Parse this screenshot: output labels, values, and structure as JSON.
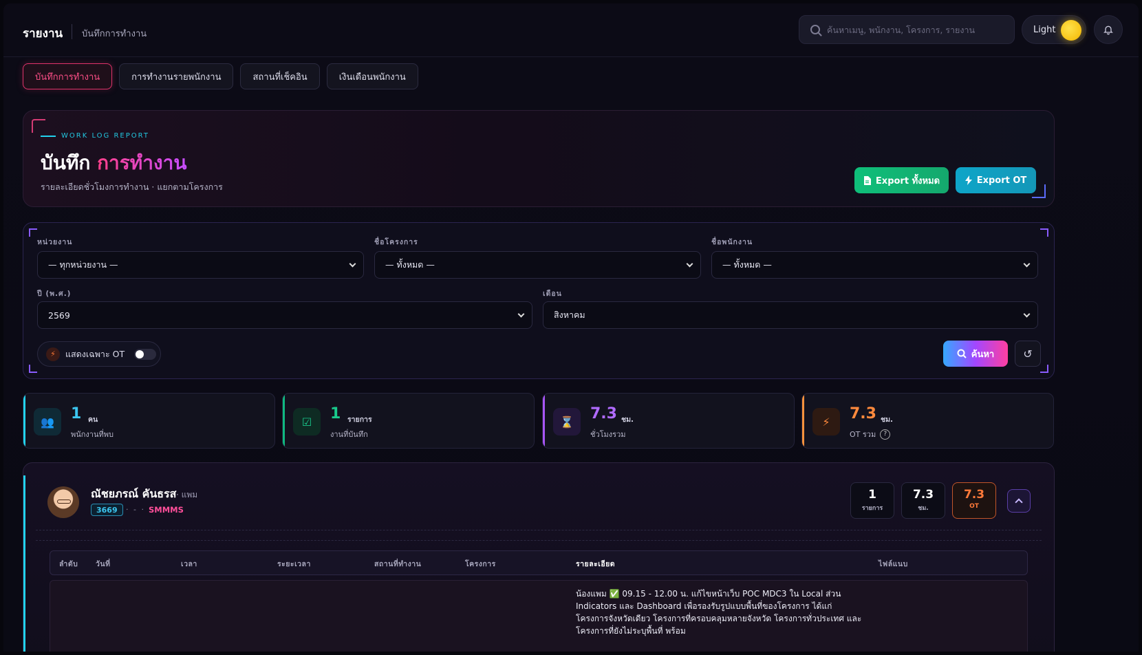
{
  "header": {
    "title": "รายงาน",
    "subtitle": "บันทึกการทำงาน",
    "search_placeholder": "ค้นหาเมนู, พนักงาน, โครงการ, รายงาน",
    "theme_label": "Light"
  },
  "tabs": [
    {
      "label": "บันทึกการทำงาน",
      "active": true
    },
    {
      "label": "การทำงานรายพนักงาน",
      "active": false
    },
    {
      "label": "สถานที่เช็คอิน",
      "active": false
    },
    {
      "label": "เงินเดือนพนักงาน",
      "active": false
    }
  ],
  "hero": {
    "eyebrow": "WORK LOG REPORT",
    "title_main": "บันทึก",
    "title_accent": "การทำงาน",
    "subtitle": "รายละเอียดชั่วโมงการทำงาน · แยกตามโครงการ",
    "export_all_label": "Export ทั้งหมด",
    "export_ot_label": "Export OT"
  },
  "filters": {
    "unit_label": "หน่วยงาน",
    "unit_value": "— ทุกหน่วยงาน —",
    "project_label": "ชื่อโครงการ",
    "project_value": "— ทั้งหมด —",
    "employee_label": "ชื่อพนักงาน",
    "employee_value": "— ทั้งหมด —",
    "year_label": "ปี (พ.ศ.)",
    "year_value": "2569",
    "month_label": "เดือน",
    "month_value": "สิงหาคม",
    "ot_only_label": "แสดงเฉพาะ OT",
    "ot_only_on": false,
    "search_label": "ค้นหา"
  },
  "stats": [
    {
      "value": "1",
      "unit": "คน",
      "caption": "พนักงานที่พบ",
      "color": "#22d3ee"
    },
    {
      "value": "1",
      "unit": "รายการ",
      "caption": "งานที่บันทึก",
      "color": "#10b981"
    },
    {
      "value": "7.3",
      "unit": "ชม.",
      "caption": "ชั่วโมงรวม",
      "color": "#a855f7"
    },
    {
      "value": "7.3",
      "unit": "ชม.",
      "caption": "OT รวม",
      "color": "#fb923c"
    }
  ],
  "employee": {
    "name": "ณัชยภรณ์ คันธรส",
    "nickname": "· แพม",
    "id": "3669",
    "separator": "· - ·",
    "department": "SMMMS",
    "count_value": "1",
    "count_label": "รายการ",
    "hours_value": "7.3",
    "hours_label": "ชม.",
    "ot_value": "7.3",
    "ot_label": "OT"
  },
  "table": {
    "columns": [
      "ลำดับ",
      "วันที่",
      "เวลา",
      "ระยะเวลา",
      "สถานที่ทำงาน",
      "โครงการ",
      "รายละเอียด",
      "ไฟล์แนบ"
    ],
    "rows": [
      {
        "detail": "น้องแพม ✅ 09.15 - 12.00 น. แก้ไขหน้าเว็บ POC MDC3 ใน Local ส่วน Indicators และ Dashboard เพื่อรองรับรูปแบบพื้นที่ของโครงการ ได้แก่ โครงการจังหวัดเดียว โครงการที่ครอบคลุมหลายจังหวัด โครงการทั่วประเทศ และโครงการที่ยังไม่ระบุพื้นที่ พร้อม"
      }
    ]
  },
  "colors": {
    "accent_pink": "#ff4f88",
    "accent_cyan": "#22d3ee",
    "accent_green": "#10b981",
    "accent_orange": "#ff7a3a"
  }
}
